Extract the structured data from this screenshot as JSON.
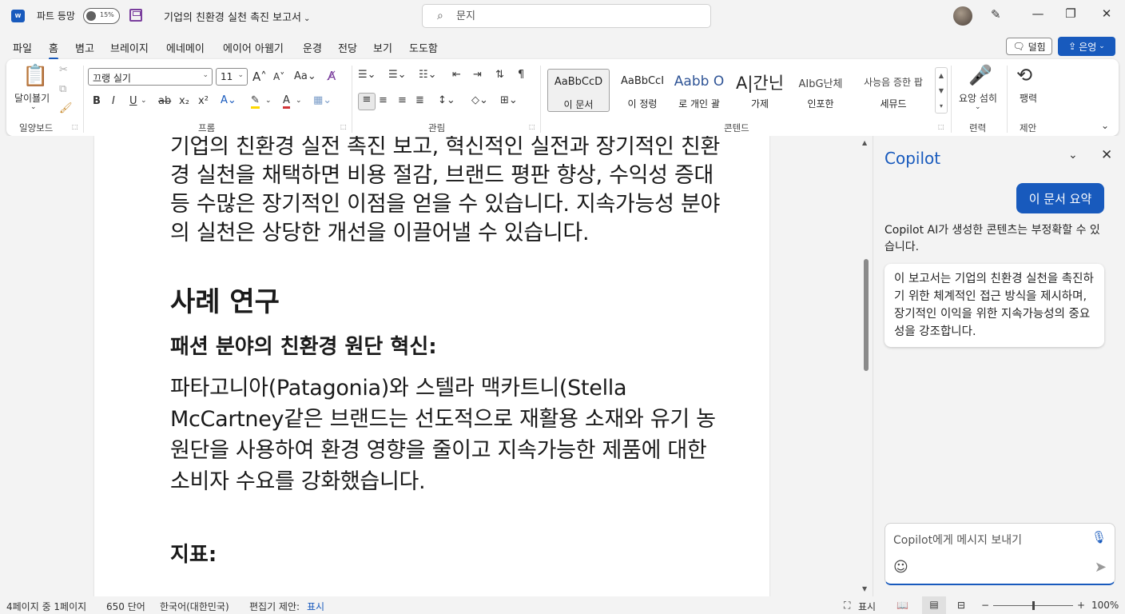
{
  "titlebar": {
    "app_icon": "word-app-icon",
    "autosave_label": "파트 등망",
    "autosave_state": "15%",
    "doc_title": "기업의 친환경 실천 촉진 보고서",
    "search_placeholder": "문지",
    "minimize": "—",
    "maximize": "❐",
    "close": "✕"
  },
  "tabs": [
    "파일",
    "홈",
    "볌고",
    "브레이지",
    "에네메이",
    "에이어 아웸기",
    "운경",
    "전당",
    "보기",
    "도도함"
  ],
  "header_buttons": {
    "comment": "덜힘",
    "share": "은엉"
  },
  "ribbon": {
    "clipboard": {
      "paste_label": "달이뵬기",
      "group": "일양보드"
    },
    "font": {
      "font_name": "끄랭 실기",
      "font_size": "11",
      "group": "프롬"
    },
    "paragraph": {
      "group": "관림"
    },
    "styles": {
      "group": "콘텐드",
      "items": [
        {
          "sample": "AaBbCcD",
          "name": "이 문서"
        },
        {
          "sample": "AaBbCcI",
          "name": "이 정렁"
        },
        {
          "sample": "Aabb O",
          "name": "로 개인 괄"
        },
        {
          "sample": "A|간닌",
          "name": "가제"
        },
        {
          "sample": "AIbG난체",
          "name": "인포한"
        },
        {
          "sample": "사능음 증한 팝",
          "name": "세뮤드"
        }
      ]
    },
    "voice": {
      "label": "요앙 섬히",
      "group": "련력"
    },
    "history": {
      "label": "팽력",
      "group": "제안"
    }
  },
  "document": {
    "para1": "기업의 친환경 실전 촉진 보고, 혁신적인 실전과 장기적인 친환경 실천을 채택하면 비용 절감, 브랜드 평판 향상, 수익성 증대 등 수많은 장기적인 이점을 얻을 수 있습니다. 지속가능성 분야의 실천은 상당한 개선을 이끌어낼 수 있습니다.",
    "heading1": "사례 연구",
    "heading2": "패션 분야의 친환경 원단 혁신:",
    "para2": "파타고니아(Patagonia)와 스텔라 맥카트니(Stella McCartney같은 브랜드는 선도적으로 재활용 소재와 유기 농 원단을 사용하여 환경 영향을 줄이고 지속가능한 제품에 대한 소비자 수요를 강화했습니다.",
    "heading3": "지표:"
  },
  "copilot": {
    "title": "Copilot",
    "user_message": "이 문서 요약",
    "disclaimer": "Copilot AI가 생성한 콘텐츠는 부정확할 수 있습니다.",
    "ai_response": "이 보고서는 기업의 친환경 실천을 촉진하기 위한 체계적인 접근 방식을 제시하며, 장기적인 이익을 위한 지속가능성의 중요성을 강조합니다.",
    "input_placeholder": "Copilot에게 메시지 보내기"
  },
  "statusbar": {
    "page": "4페이지 중 1페이지",
    "words": "650 단어",
    "language": "한국어(대한민국)",
    "editor_label": "편집기 제안:",
    "editor_link": "표시",
    "display_settings": "표시",
    "zoom": "100%"
  }
}
